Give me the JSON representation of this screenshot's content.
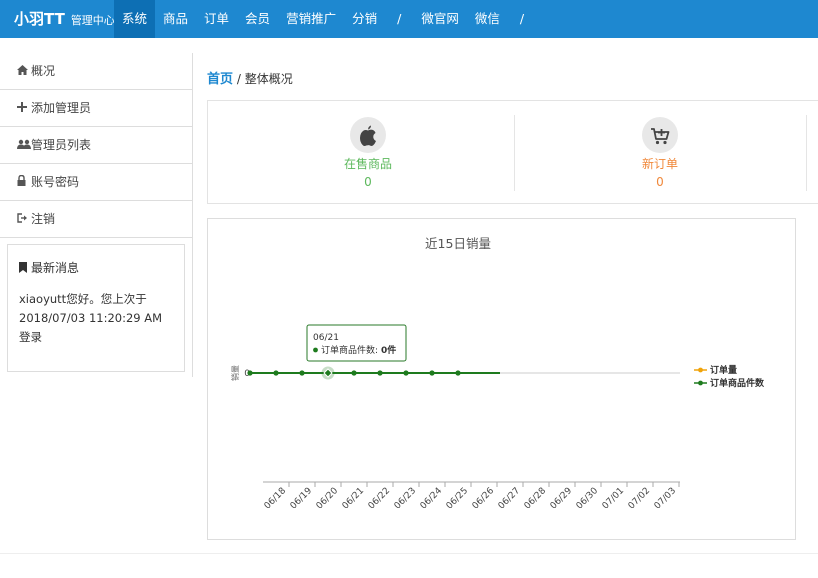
{
  "header": {
    "brand": "小羽TT",
    "brand_sub": "管理中心",
    "nav": [
      "系统",
      "商品",
      "订单",
      "会员",
      "营销推广",
      "分销",
      "/",
      "微官网",
      "微信",
      "/"
    ]
  },
  "sidebar": {
    "items": [
      {
        "label": "概况",
        "icon": "home-icon"
      },
      {
        "label": "添加管理员",
        "icon": "plus-icon"
      },
      {
        "label": "管理员列表",
        "icon": "users-icon"
      },
      {
        "label": "账号密码",
        "icon": "lock-icon"
      },
      {
        "label": "注销",
        "icon": "sign-out-icon"
      }
    ],
    "message": {
      "title": "最新消息",
      "body": "xiaoyutt您好。您上次于2018/07/03 11:20:29 AM登录"
    }
  },
  "breadcrumb": {
    "home": "首页",
    "sep": "/",
    "current": "整体概况"
  },
  "stats": [
    {
      "label": "在售商品",
      "value": "0",
      "icon": "apple-icon",
      "color": "#5cb85c"
    },
    {
      "label": "新订单",
      "value": "0",
      "icon": "cart-icon",
      "color": "#f0883a"
    }
  ],
  "chart_data": {
    "type": "line",
    "title": "近15日销量",
    "ylabel": "销量",
    "categories": [
      "06/18",
      "06/19",
      "06/20",
      "06/21",
      "06/22",
      "06/23",
      "06/24",
      "06/25",
      "06/26",
      "06/27",
      "06/28",
      "06/29",
      "06/30",
      "07/01",
      "07/02",
      "07/03"
    ],
    "yticks": [
      "0"
    ],
    "series": [
      {
        "name": "订单量",
        "color": "#f0a30a",
        "values": []
      },
      {
        "name": "订单商品件数",
        "color": "#1e7b1e",
        "values": [
          0,
          0,
          0,
          0,
          0,
          0,
          0,
          0,
          0
        ]
      }
    ],
    "legend": "right",
    "tooltip": {
      "category": "06/21",
      "series": "订单商品件数",
      "sep": ":",
      "value": "0件"
    }
  }
}
